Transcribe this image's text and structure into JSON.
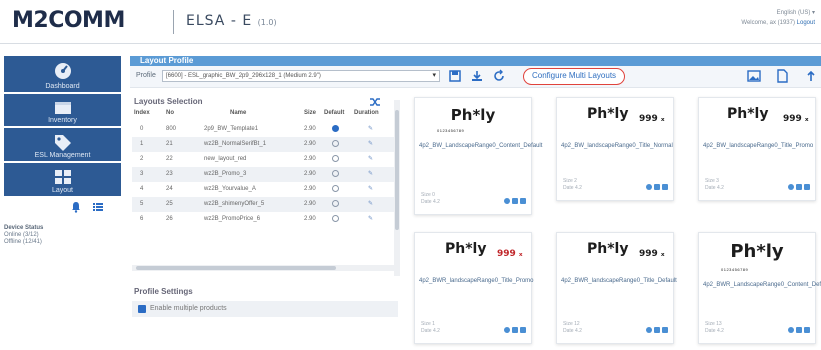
{
  "header": {
    "logo": "M2COMM",
    "app_name": "ELSA - E",
    "app_version": "(1.0)",
    "language": "English (US) ▾",
    "welcome": "Welcome, ax (1937)",
    "logout": "Logout"
  },
  "sidebar": {
    "items": [
      {
        "label": "Dashboard",
        "icon": "dashboard-gauge-icon"
      },
      {
        "label": "Inventory",
        "icon": "inventory-box-icon"
      },
      {
        "label": "ESL Management",
        "icon": "tag-icon"
      },
      {
        "label": "Layout",
        "icon": "layout-grid-icon"
      }
    ],
    "device_status": {
      "title": "Device Status",
      "lines": [
        "Online (3/12)",
        "Offline (12/41)"
      ]
    }
  },
  "panel": {
    "title": "Layout Profile",
    "profile_label": "Profile",
    "profile_value": "[6600] - ESL_graphic_BW_2p9_296x128_1 (Medium 2.9\")",
    "configure_link": "Configure Multi Layouts"
  },
  "layouts_selection": {
    "title": "Layouts Selection",
    "columns": [
      "Index",
      "No",
      "Name",
      "Size",
      "Default",
      "Duration"
    ],
    "rows": [
      {
        "index": "0",
        "no": "800",
        "name": "2p9_BW_Template1",
        "size": "2.90",
        "default": true
      },
      {
        "index": "1",
        "no": "21",
        "name": "wz2B_NormalSerifBt_1",
        "size": "2.90",
        "default": false
      },
      {
        "index": "2",
        "no": "22",
        "name": "new_layout_red",
        "size": "2.90",
        "default": false
      },
      {
        "index": "3",
        "no": "23",
        "name": "wz2B_Promo_3",
        "size": "2.90",
        "default": false
      },
      {
        "index": "4",
        "no": "24",
        "name": "wz2B_Yourvalue_A",
        "size": "2.90",
        "default": false
      },
      {
        "index": "5",
        "no": "25",
        "name": "wz2B_shimenyOffer_5",
        "size": "2.90",
        "default": false
      },
      {
        "index": "6",
        "no": "26",
        "name": "wz2B_PromoPrice_6",
        "size": "2.90",
        "default": false
      }
    ]
  },
  "profile_settings": {
    "title": "Profile Settings",
    "checkbox_label": "Enable multiple products"
  },
  "cards": [
    {
      "ph": "Ph*ly",
      "barcode": "0123456789",
      "price": "",
      "name": "4p2_BW_LandscapeRange0_Content_Default",
      "meta": [
        "Size 0",
        "Date 4.2"
      ]
    },
    {
      "ph": "Ph*ly",
      "barcode": "",
      "price": "999 ₓ",
      "name": "4p2_BW_landscapeRange0_Title_Normal",
      "meta": [
        "Size 2",
        "Date 4.2"
      ]
    },
    {
      "ph": "Ph*ly",
      "barcode": "",
      "price": "999 ₓ",
      "name": "4p2_BW_landscapeRange0_Title_Promo",
      "meta": [
        "Size 3",
        "Date 4.2"
      ]
    },
    {
      "ph": "Ph*ly",
      "barcode": "",
      "price": "999 ₓ",
      "name": "4p2_BWR_landscapeRange0_Title_Promo",
      "meta": [
        "Size 1",
        "Date 4.2"
      ]
    },
    {
      "ph": "Ph*ly",
      "barcode": "",
      "price": "999 ₓ",
      "name": "4p2_BWR_landscapeRange0_Title_Default",
      "meta": [
        "Size 12",
        "Date 4.2"
      ]
    },
    {
      "ph": "Ph*ly",
      "barcode": "0123456789",
      "price": "",
      "name": "4p2_BWR_LandscapeRange0_Content_Default",
      "meta": [
        "Size 13",
        "Date 4.2"
      ]
    }
  ],
  "colors": {
    "nav": "#2d5a94",
    "panel_header": "#5b9bd5",
    "link": "#2f6fc0",
    "highlight_ring": "#e0433c",
    "price_red": "#c0262a"
  }
}
